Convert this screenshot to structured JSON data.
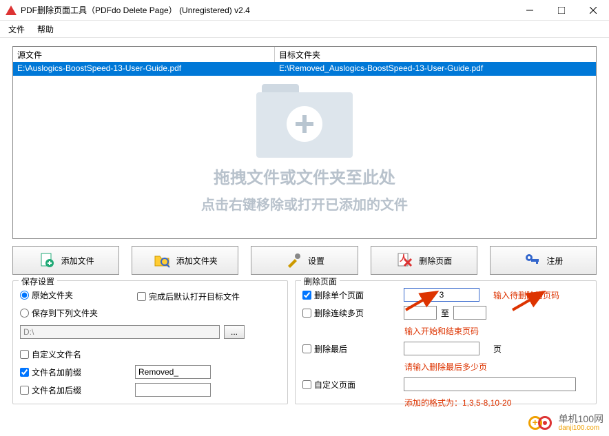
{
  "window": {
    "title": "PDF删除页面工具（PDFdo Delete Page） (Unregistered) v2.4"
  },
  "menu": {
    "file": "文件",
    "help": "帮助"
  },
  "table": {
    "col_source": "源文件",
    "col_target": "目标文件夹",
    "row_source": "E:\\Auslogics-BoostSpeed-13-User-Guide.pdf",
    "row_target": "E:\\Removed_Auslogics-BoostSpeed-13-User-Guide.pdf"
  },
  "drop": {
    "line1": "拖拽文件或文件夹至此处",
    "line2": "点击右键移除或打开已添加的文件"
  },
  "buttons": {
    "add_file": "添加文件",
    "add_folder": "添加文件夹",
    "settings": "设置",
    "delete_page": "删除页面",
    "register": "注册"
  },
  "save": {
    "legend": "保存设置",
    "opt_original": "原始文件夹",
    "opt_below": "保存到下列文件夹",
    "folder_value": "D:\\",
    "open_after": "完成后默认打开目标文件",
    "custom_name": "自定义文件名",
    "add_prefix": "文件名加前缀",
    "add_suffix": "文件名加后缀",
    "prefix_value": "Removed_",
    "suffix_value": ""
  },
  "delete": {
    "legend": "删除页面",
    "single": "删除单个页面",
    "single_value": "3",
    "single_hint": "输入待删除的页码",
    "range": "删除连续多页",
    "range_to": "至",
    "range_hint": "输入开始和结束页码",
    "last": "删除最后",
    "last_unit": "页",
    "last_hint": "请输入删除最后多少页",
    "custom": "自定义页面",
    "custom_hint": "添加的格式为：1,3,5-8,10-20"
  },
  "watermark": {
    "name": "单机100网",
    "url": "danji100.com"
  }
}
